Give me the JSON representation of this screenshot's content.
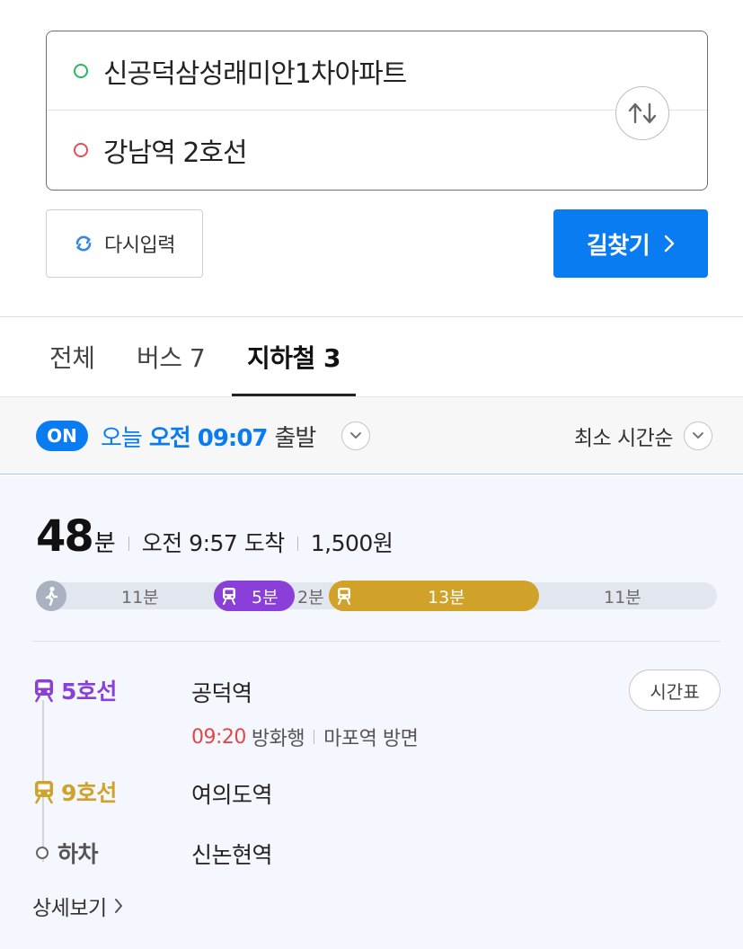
{
  "search": {
    "origin": "신공덕삼성래미안1차아파트",
    "destination": "강남역 2호선"
  },
  "actions": {
    "reset_label": "다시입력",
    "find_label": "길찾기"
  },
  "tabs": [
    {
      "label": "전체"
    },
    {
      "label": "버스 7"
    },
    {
      "label": "지하철 3"
    }
  ],
  "departure": {
    "on_badge": "ON",
    "today": "오늘",
    "time": "오전 09:07",
    "suffix": "출발",
    "sort_label": "최소 시간순"
  },
  "route": {
    "duration_num": "48",
    "duration_unit": "분",
    "arrival": "오전 9:57 도착",
    "fare": "1,500원",
    "segments": {
      "walk1": "11분",
      "line5": "5분",
      "transfer": "2분",
      "line9": "13분",
      "walk2": "11분"
    },
    "steps": [
      {
        "line": "5호선",
        "station": "공덕역"
      },
      {
        "line": "9호선",
        "station": "여의도역"
      },
      {
        "line": "하차",
        "station": "신논현역"
      }
    ],
    "detail": {
      "time": "09:20",
      "direction": "방화행",
      "platform": "마포역 방면"
    },
    "timetable_label": "시간표",
    "more_label": "상세보기"
  },
  "colors": {
    "primary": "#0a7cf2",
    "line5": "#8b3fd9",
    "line9": "#d1a22a",
    "walk": "#aab2c2",
    "red": "#e04848"
  }
}
